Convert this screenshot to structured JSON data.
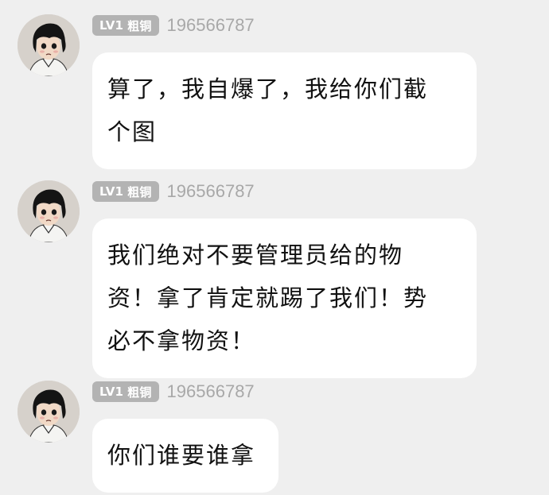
{
  "messages": [
    {
      "level": "LV1",
      "rank": "粗铜",
      "user_id": "196566787",
      "lines": [
        "算了，我自爆了，我给你们截",
        "个图"
      ]
    },
    {
      "level": "LV1",
      "rank": "粗铜",
      "user_id": "196566787",
      "lines": [
        "我们绝对不要管理员给的物",
        "资！拿了肯定就踢了我们！势",
        "必不拿物资！"
      ]
    },
    {
      "level": "LV1",
      "rank": "粗铜",
      "user_id": "196566787",
      "lines": [
        "你们谁要谁拿"
      ]
    }
  ],
  "icons": {
    "avatar": "anime-boy-avatar-icon"
  },
  "colors": {
    "background": "#efefef",
    "bubble": "#ffffff",
    "badge": "#b3b3b3",
    "user_id": "#a8a8a8"
  }
}
